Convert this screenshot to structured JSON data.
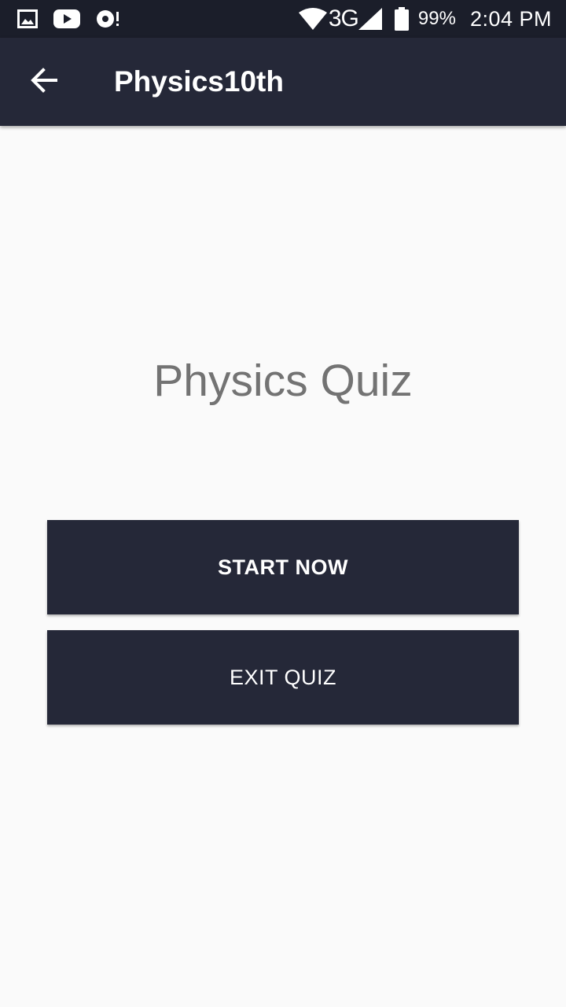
{
  "status_bar": {
    "left_icons": [
      "gallery-icon",
      "youtube-icon",
      "sync-alert-icon"
    ],
    "network_type": "3G",
    "battery_percent": "99%",
    "time": "2:04 PM"
  },
  "app_bar": {
    "back_icon": "arrow-left-icon",
    "title": "Physics10th"
  },
  "main": {
    "heading": "Physics Quiz",
    "start_button_label": "START NOW",
    "exit_button_label": "EXIT QUIZ"
  },
  "colors": {
    "status_bar_bg": "#1b1e2a",
    "primary": "#252838",
    "background": "#fafafa",
    "heading_text": "#737373",
    "on_primary": "#ffffff"
  }
}
